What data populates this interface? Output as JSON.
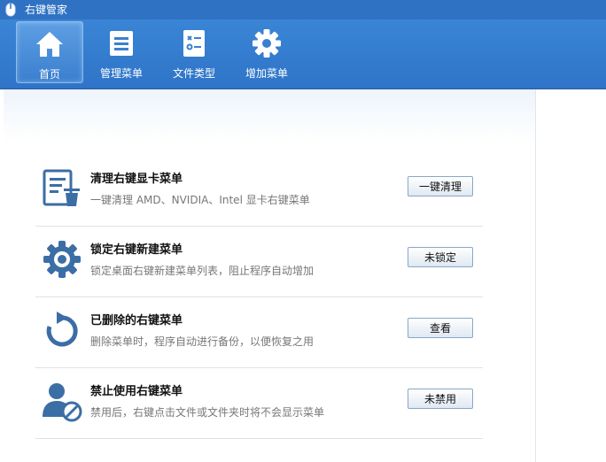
{
  "window": {
    "title": "右键管家"
  },
  "toolbar": {
    "tabs": [
      {
        "label": "首页",
        "icon": "home-icon",
        "active": true
      },
      {
        "label": "管理菜单",
        "icon": "list-icon",
        "active": false
      },
      {
        "label": "文件类型",
        "icon": "file-type-icon",
        "active": false
      },
      {
        "label": "增加菜单",
        "icon": "gear-icon",
        "active": false
      }
    ]
  },
  "items": [
    {
      "title": "清理右键显卡菜单",
      "desc": "一键清理 AMD、NVIDIA、Intel 显卡右键菜单",
      "button": "一键清理",
      "icon": "clean-menu-icon"
    },
    {
      "title": "锁定右键新建菜单",
      "desc": "锁定桌面右键新建菜单列表，阻止程序自动增加",
      "button": "未锁定",
      "icon": "gear-lock-icon"
    },
    {
      "title": "已删除的右键菜单",
      "desc": "删除菜单时，程序自动进行备份，以便恢复之用",
      "button": "查看",
      "icon": "restore-icon"
    },
    {
      "title": "禁止使用右键菜单",
      "desc": "禁用后，右键点击文件或文件夹时将不会显示菜单",
      "button": "未禁用",
      "icon": "user-block-icon"
    }
  ],
  "colors": {
    "accent": "#2f72c4",
    "icon": "#3b6ea5"
  }
}
